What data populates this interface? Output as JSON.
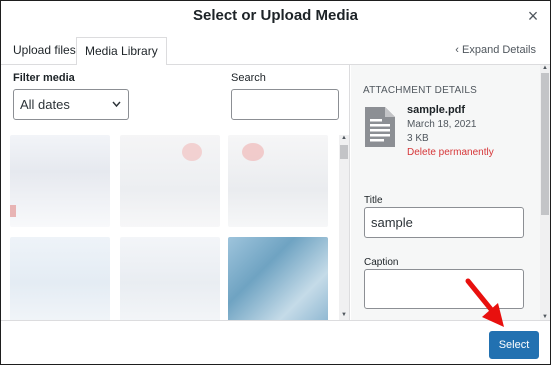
{
  "dialog": {
    "title": "Select or Upload Media",
    "close_icon": "×"
  },
  "tabs": [
    {
      "label": "Upload files"
    },
    {
      "label": "Media Library"
    }
  ],
  "expand": {
    "label": "‹ Expand Details"
  },
  "filters": {
    "filter_label": "Filter media",
    "date_select": "All dates",
    "search_label": "Search",
    "search_value": ""
  },
  "attachment": {
    "heading": "ATTACHMENT DETAILS",
    "file_name": "sample.pdf",
    "date": "March 18, 2021",
    "size": "3 KB",
    "delete_label": "Delete permanently",
    "title_label": "Title",
    "title_value": "sample",
    "caption_label": "Caption",
    "caption_value": ""
  },
  "footer": {
    "select_label": "Select"
  },
  "colors": {
    "accent": "#2271b1",
    "delete": "#d63638",
    "arrow": "#e8100e"
  }
}
